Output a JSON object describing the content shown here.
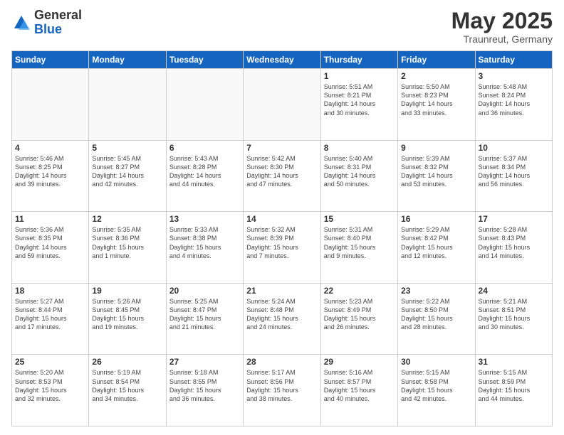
{
  "logo": {
    "general": "General",
    "blue": "Blue"
  },
  "title": "May 2025",
  "subtitle": "Traunreut, Germany",
  "days_of_week": [
    "Sunday",
    "Monday",
    "Tuesday",
    "Wednesday",
    "Thursday",
    "Friday",
    "Saturday"
  ],
  "weeks": [
    [
      {
        "day": "",
        "info": ""
      },
      {
        "day": "",
        "info": ""
      },
      {
        "day": "",
        "info": ""
      },
      {
        "day": "",
        "info": ""
      },
      {
        "day": "1",
        "info": "Sunrise: 5:51 AM\nSunset: 8:21 PM\nDaylight: 14 hours\nand 30 minutes."
      },
      {
        "day": "2",
        "info": "Sunrise: 5:50 AM\nSunset: 8:23 PM\nDaylight: 14 hours\nand 33 minutes."
      },
      {
        "day": "3",
        "info": "Sunrise: 5:48 AM\nSunset: 8:24 PM\nDaylight: 14 hours\nand 36 minutes."
      }
    ],
    [
      {
        "day": "4",
        "info": "Sunrise: 5:46 AM\nSunset: 8:25 PM\nDaylight: 14 hours\nand 39 minutes."
      },
      {
        "day": "5",
        "info": "Sunrise: 5:45 AM\nSunset: 8:27 PM\nDaylight: 14 hours\nand 42 minutes."
      },
      {
        "day": "6",
        "info": "Sunrise: 5:43 AM\nSunset: 8:28 PM\nDaylight: 14 hours\nand 44 minutes."
      },
      {
        "day": "7",
        "info": "Sunrise: 5:42 AM\nSunset: 8:30 PM\nDaylight: 14 hours\nand 47 minutes."
      },
      {
        "day": "8",
        "info": "Sunrise: 5:40 AM\nSunset: 8:31 PM\nDaylight: 14 hours\nand 50 minutes."
      },
      {
        "day": "9",
        "info": "Sunrise: 5:39 AM\nSunset: 8:32 PM\nDaylight: 14 hours\nand 53 minutes."
      },
      {
        "day": "10",
        "info": "Sunrise: 5:37 AM\nSunset: 8:34 PM\nDaylight: 14 hours\nand 56 minutes."
      }
    ],
    [
      {
        "day": "11",
        "info": "Sunrise: 5:36 AM\nSunset: 8:35 PM\nDaylight: 14 hours\nand 59 minutes."
      },
      {
        "day": "12",
        "info": "Sunrise: 5:35 AM\nSunset: 8:36 PM\nDaylight: 15 hours\nand 1 minute."
      },
      {
        "day": "13",
        "info": "Sunrise: 5:33 AM\nSunset: 8:38 PM\nDaylight: 15 hours\nand 4 minutes."
      },
      {
        "day": "14",
        "info": "Sunrise: 5:32 AM\nSunset: 8:39 PM\nDaylight: 15 hours\nand 7 minutes."
      },
      {
        "day": "15",
        "info": "Sunrise: 5:31 AM\nSunset: 8:40 PM\nDaylight: 15 hours\nand 9 minutes."
      },
      {
        "day": "16",
        "info": "Sunrise: 5:29 AM\nSunset: 8:42 PM\nDaylight: 15 hours\nand 12 minutes."
      },
      {
        "day": "17",
        "info": "Sunrise: 5:28 AM\nSunset: 8:43 PM\nDaylight: 15 hours\nand 14 minutes."
      }
    ],
    [
      {
        "day": "18",
        "info": "Sunrise: 5:27 AM\nSunset: 8:44 PM\nDaylight: 15 hours\nand 17 minutes."
      },
      {
        "day": "19",
        "info": "Sunrise: 5:26 AM\nSunset: 8:45 PM\nDaylight: 15 hours\nand 19 minutes."
      },
      {
        "day": "20",
        "info": "Sunrise: 5:25 AM\nSunset: 8:47 PM\nDaylight: 15 hours\nand 21 minutes."
      },
      {
        "day": "21",
        "info": "Sunrise: 5:24 AM\nSunset: 8:48 PM\nDaylight: 15 hours\nand 24 minutes."
      },
      {
        "day": "22",
        "info": "Sunrise: 5:23 AM\nSunset: 8:49 PM\nDaylight: 15 hours\nand 26 minutes."
      },
      {
        "day": "23",
        "info": "Sunrise: 5:22 AM\nSunset: 8:50 PM\nDaylight: 15 hours\nand 28 minutes."
      },
      {
        "day": "24",
        "info": "Sunrise: 5:21 AM\nSunset: 8:51 PM\nDaylight: 15 hours\nand 30 minutes."
      }
    ],
    [
      {
        "day": "25",
        "info": "Sunrise: 5:20 AM\nSunset: 8:53 PM\nDaylight: 15 hours\nand 32 minutes."
      },
      {
        "day": "26",
        "info": "Sunrise: 5:19 AM\nSunset: 8:54 PM\nDaylight: 15 hours\nand 34 minutes."
      },
      {
        "day": "27",
        "info": "Sunrise: 5:18 AM\nSunset: 8:55 PM\nDaylight: 15 hours\nand 36 minutes."
      },
      {
        "day": "28",
        "info": "Sunrise: 5:17 AM\nSunset: 8:56 PM\nDaylight: 15 hours\nand 38 minutes."
      },
      {
        "day": "29",
        "info": "Sunrise: 5:16 AM\nSunset: 8:57 PM\nDaylight: 15 hours\nand 40 minutes."
      },
      {
        "day": "30",
        "info": "Sunrise: 5:15 AM\nSunset: 8:58 PM\nDaylight: 15 hours\nand 42 minutes."
      },
      {
        "day": "31",
        "info": "Sunrise: 5:15 AM\nSunset: 8:59 PM\nDaylight: 15 hours\nand 44 minutes."
      }
    ]
  ]
}
